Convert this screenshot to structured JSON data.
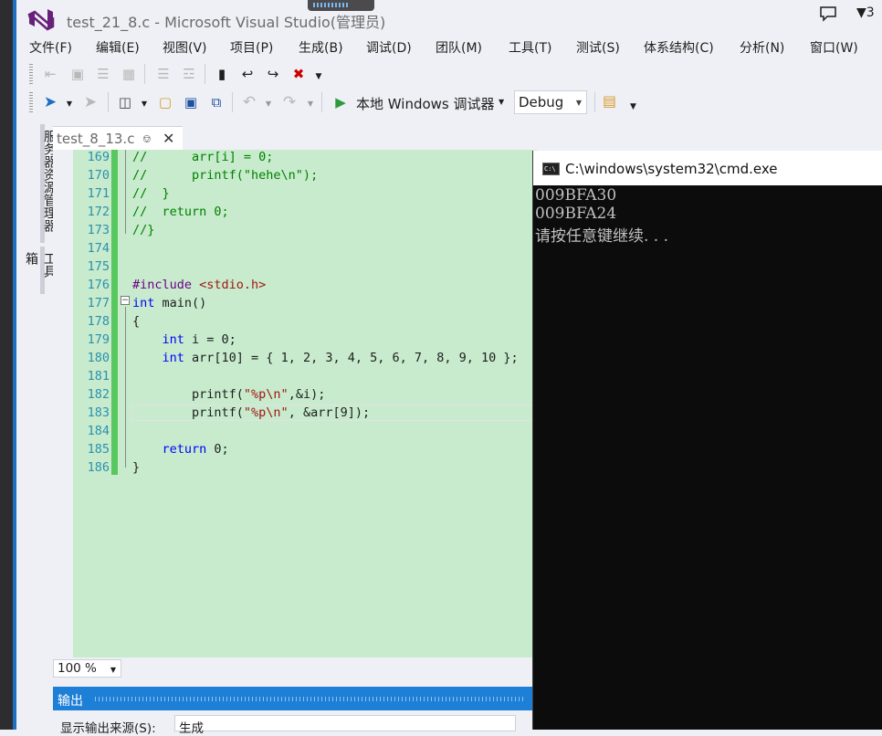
{
  "window": {
    "title": "test_21_8.c - Microsoft Visual Studio(管理员)",
    "notification_count": "3"
  },
  "menu": [
    "文件(F)",
    "编辑(E)",
    "视图(V)",
    "项目(P)",
    "生成(B)",
    "调试(D)",
    "团队(M)",
    "工具(T)",
    "测试(S)",
    "体系结构(C)",
    "分析(N)",
    "窗口(W)"
  ],
  "toolbar": {
    "debugger_label": "本地 Windows 调试器",
    "configuration": "Debug"
  },
  "side_tabs": [
    "服务器资源管理器",
    "工具箱"
  ],
  "editor": {
    "tab_name": "test_8_13.c",
    "zoom": "100 %",
    "lines": [
      {
        "n": "169",
        "text": "//      arr[i] = 0;"
      },
      {
        "n": "170",
        "text": "//      printf(\"hehe\\n\");"
      },
      {
        "n": "171",
        "text": "//  }"
      },
      {
        "n": "172",
        "text": "//  return 0;"
      },
      {
        "n": "173",
        "text": "//}"
      },
      {
        "n": "174",
        "text": ""
      },
      {
        "n": "175",
        "text": ""
      },
      {
        "n": "176",
        "text": "#include <stdio.h>"
      },
      {
        "n": "177",
        "text": "int main()"
      },
      {
        "n": "178",
        "text": "{"
      },
      {
        "n": "179",
        "text": "    int i = 0;"
      },
      {
        "n": "180",
        "text": "    int arr[10] = { 1, 2, 3, 4, 5, 6, 7, 8, 9, 10 };"
      },
      {
        "n": "181",
        "text": ""
      },
      {
        "n": "182",
        "text": "        printf(\"%p\\n\",&i);"
      },
      {
        "n": "183",
        "text": "        printf(\"%p\\n\", &arr[9]);"
      },
      {
        "n": "184",
        "text": ""
      },
      {
        "n": "185",
        "text": "    return 0;"
      },
      {
        "n": "186",
        "text": "}"
      }
    ]
  },
  "output_panel": {
    "title": "输出",
    "source_label": "显示输出来源(S):",
    "source_value": "生成"
  },
  "console": {
    "title": "C:\\windows\\system32\\cmd.exe",
    "lines": [
      "009BFA30",
      "009BFA24",
      "请按任意键继续. . ."
    ]
  },
  "icons": [
    "vs-logo-icon",
    "notification-icon",
    "filter-icon",
    "back-icon",
    "forward-icon",
    "new-project-icon",
    "open-file-icon",
    "save-icon",
    "save-all-icon",
    "undo-icon",
    "redo-icon",
    "start-icon",
    "find-icon",
    "bookmark-icon",
    "pin-icon",
    "close-icon",
    "cmd-icon"
  ],
  "colors": {
    "editor_bg": "#c7ebcc",
    "accent": "#1e7fd7",
    "console_bg": "#0c0c0c",
    "console_text": "#c0c0c0"
  }
}
